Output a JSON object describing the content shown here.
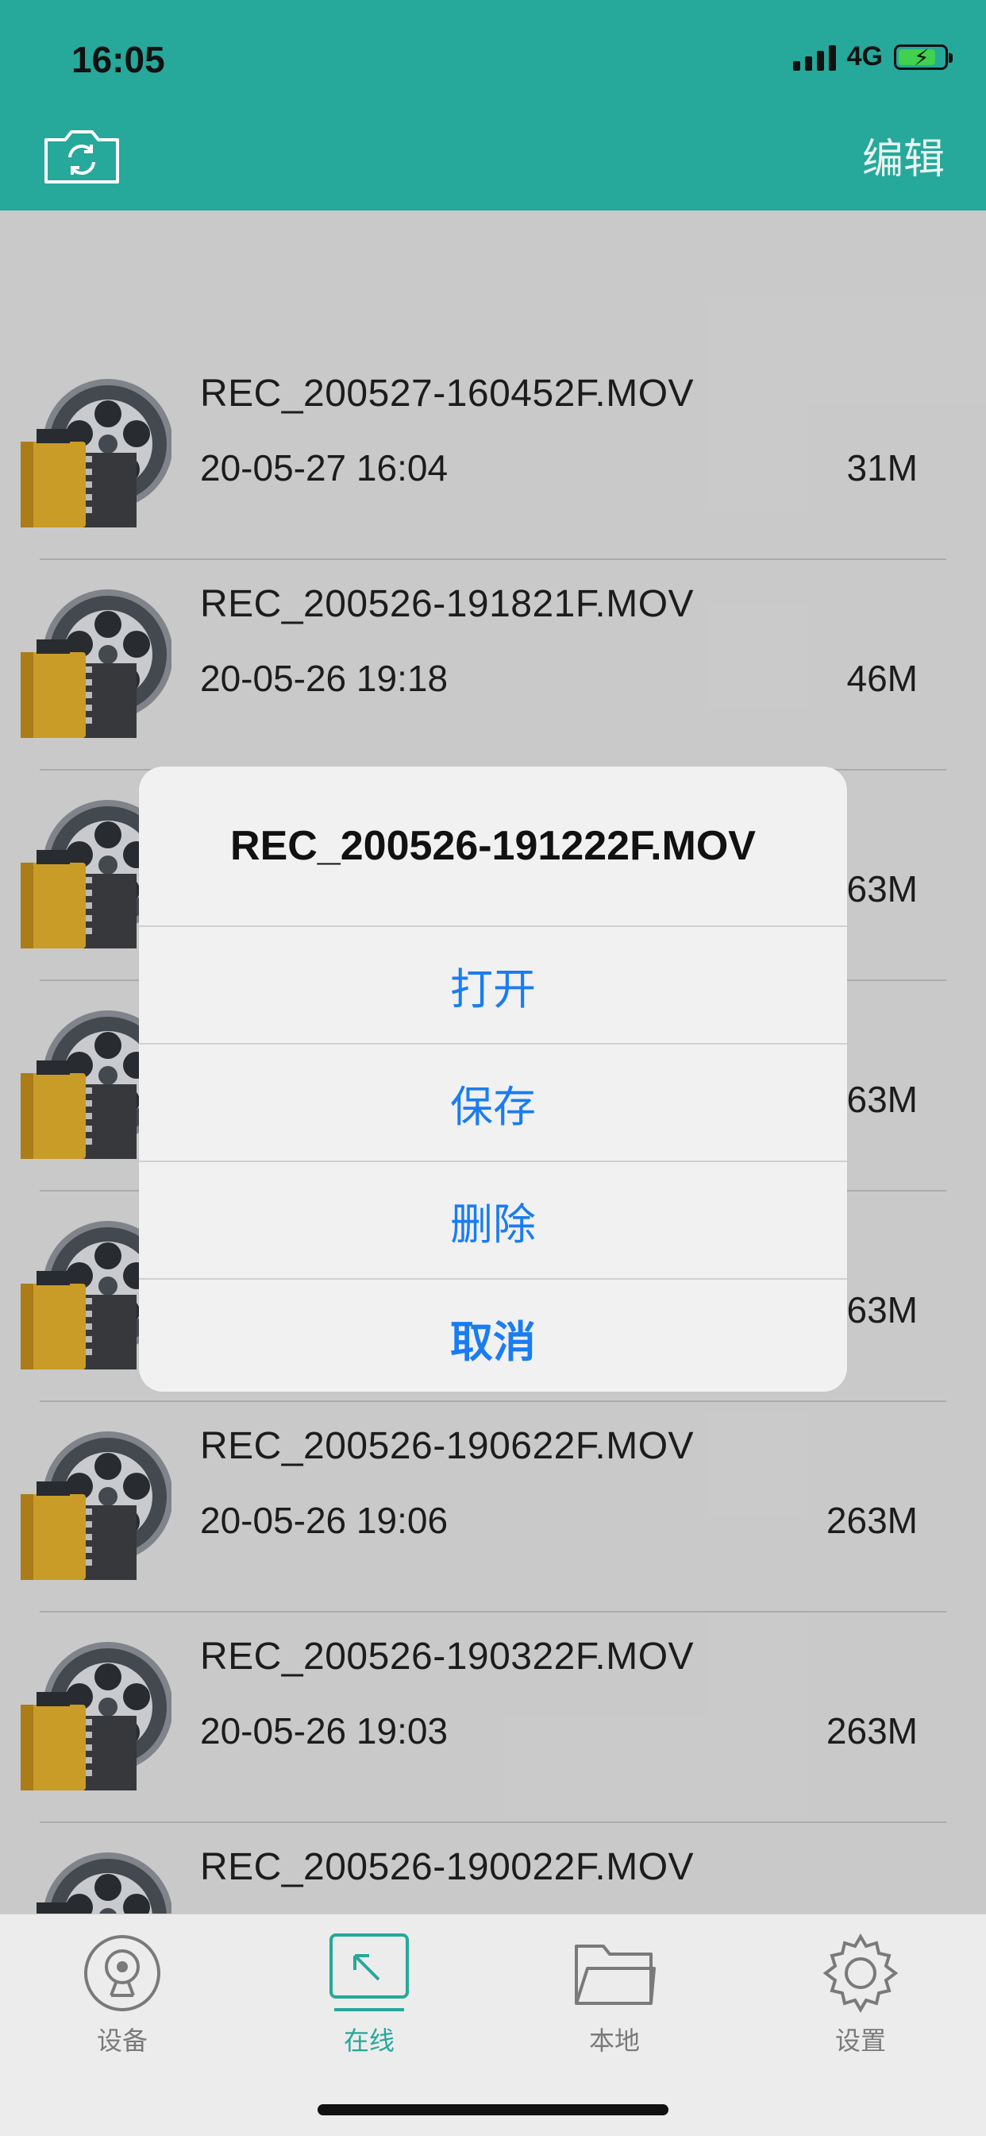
{
  "status_bar": {
    "time": "16:05",
    "network": "4G"
  },
  "header": {
    "edit_label": "编辑",
    "camera_icon": "camera-switch-icon"
  },
  "files": [
    {
      "name": "REC_200527-160452F.MOV",
      "date": "20-05-27 16:04",
      "size": "31M"
    },
    {
      "name": "REC_200526-191821F.MOV",
      "date": "20-05-26 19:18",
      "size": "46M"
    },
    {
      "name": "REC_200526-191222F.MOV",
      "date": "",
      "size": "263M"
    },
    {
      "name": "",
      "date": "",
      "size": "263M"
    },
    {
      "name": "",
      "date": "",
      "size": "263M"
    },
    {
      "name": "REC_200526-190622F.MOV",
      "date": "20-05-26 19:06",
      "size": "263M"
    },
    {
      "name": "REC_200526-190322F.MOV",
      "date": "20-05-26 19:03",
      "size": "263M"
    },
    {
      "name": "REC_200526-190022F.MOV",
      "date": "",
      "size": ""
    }
  ],
  "action_sheet": {
    "title": "REC_200526-191222F.MOV",
    "open": "打开",
    "save": "保存",
    "delete": "删除",
    "cancel": "取消"
  },
  "tabs": [
    {
      "label": "设备",
      "icon": "webcam-icon"
    },
    {
      "label": "在线",
      "icon": "arrow-up-left-icon"
    },
    {
      "label": "本地",
      "icon": "folder-icon"
    },
    {
      "label": "设置",
      "icon": "gear-icon"
    }
  ],
  "colors": {
    "accent": "#26a89a",
    "action_blue": "#1a7cf2"
  }
}
